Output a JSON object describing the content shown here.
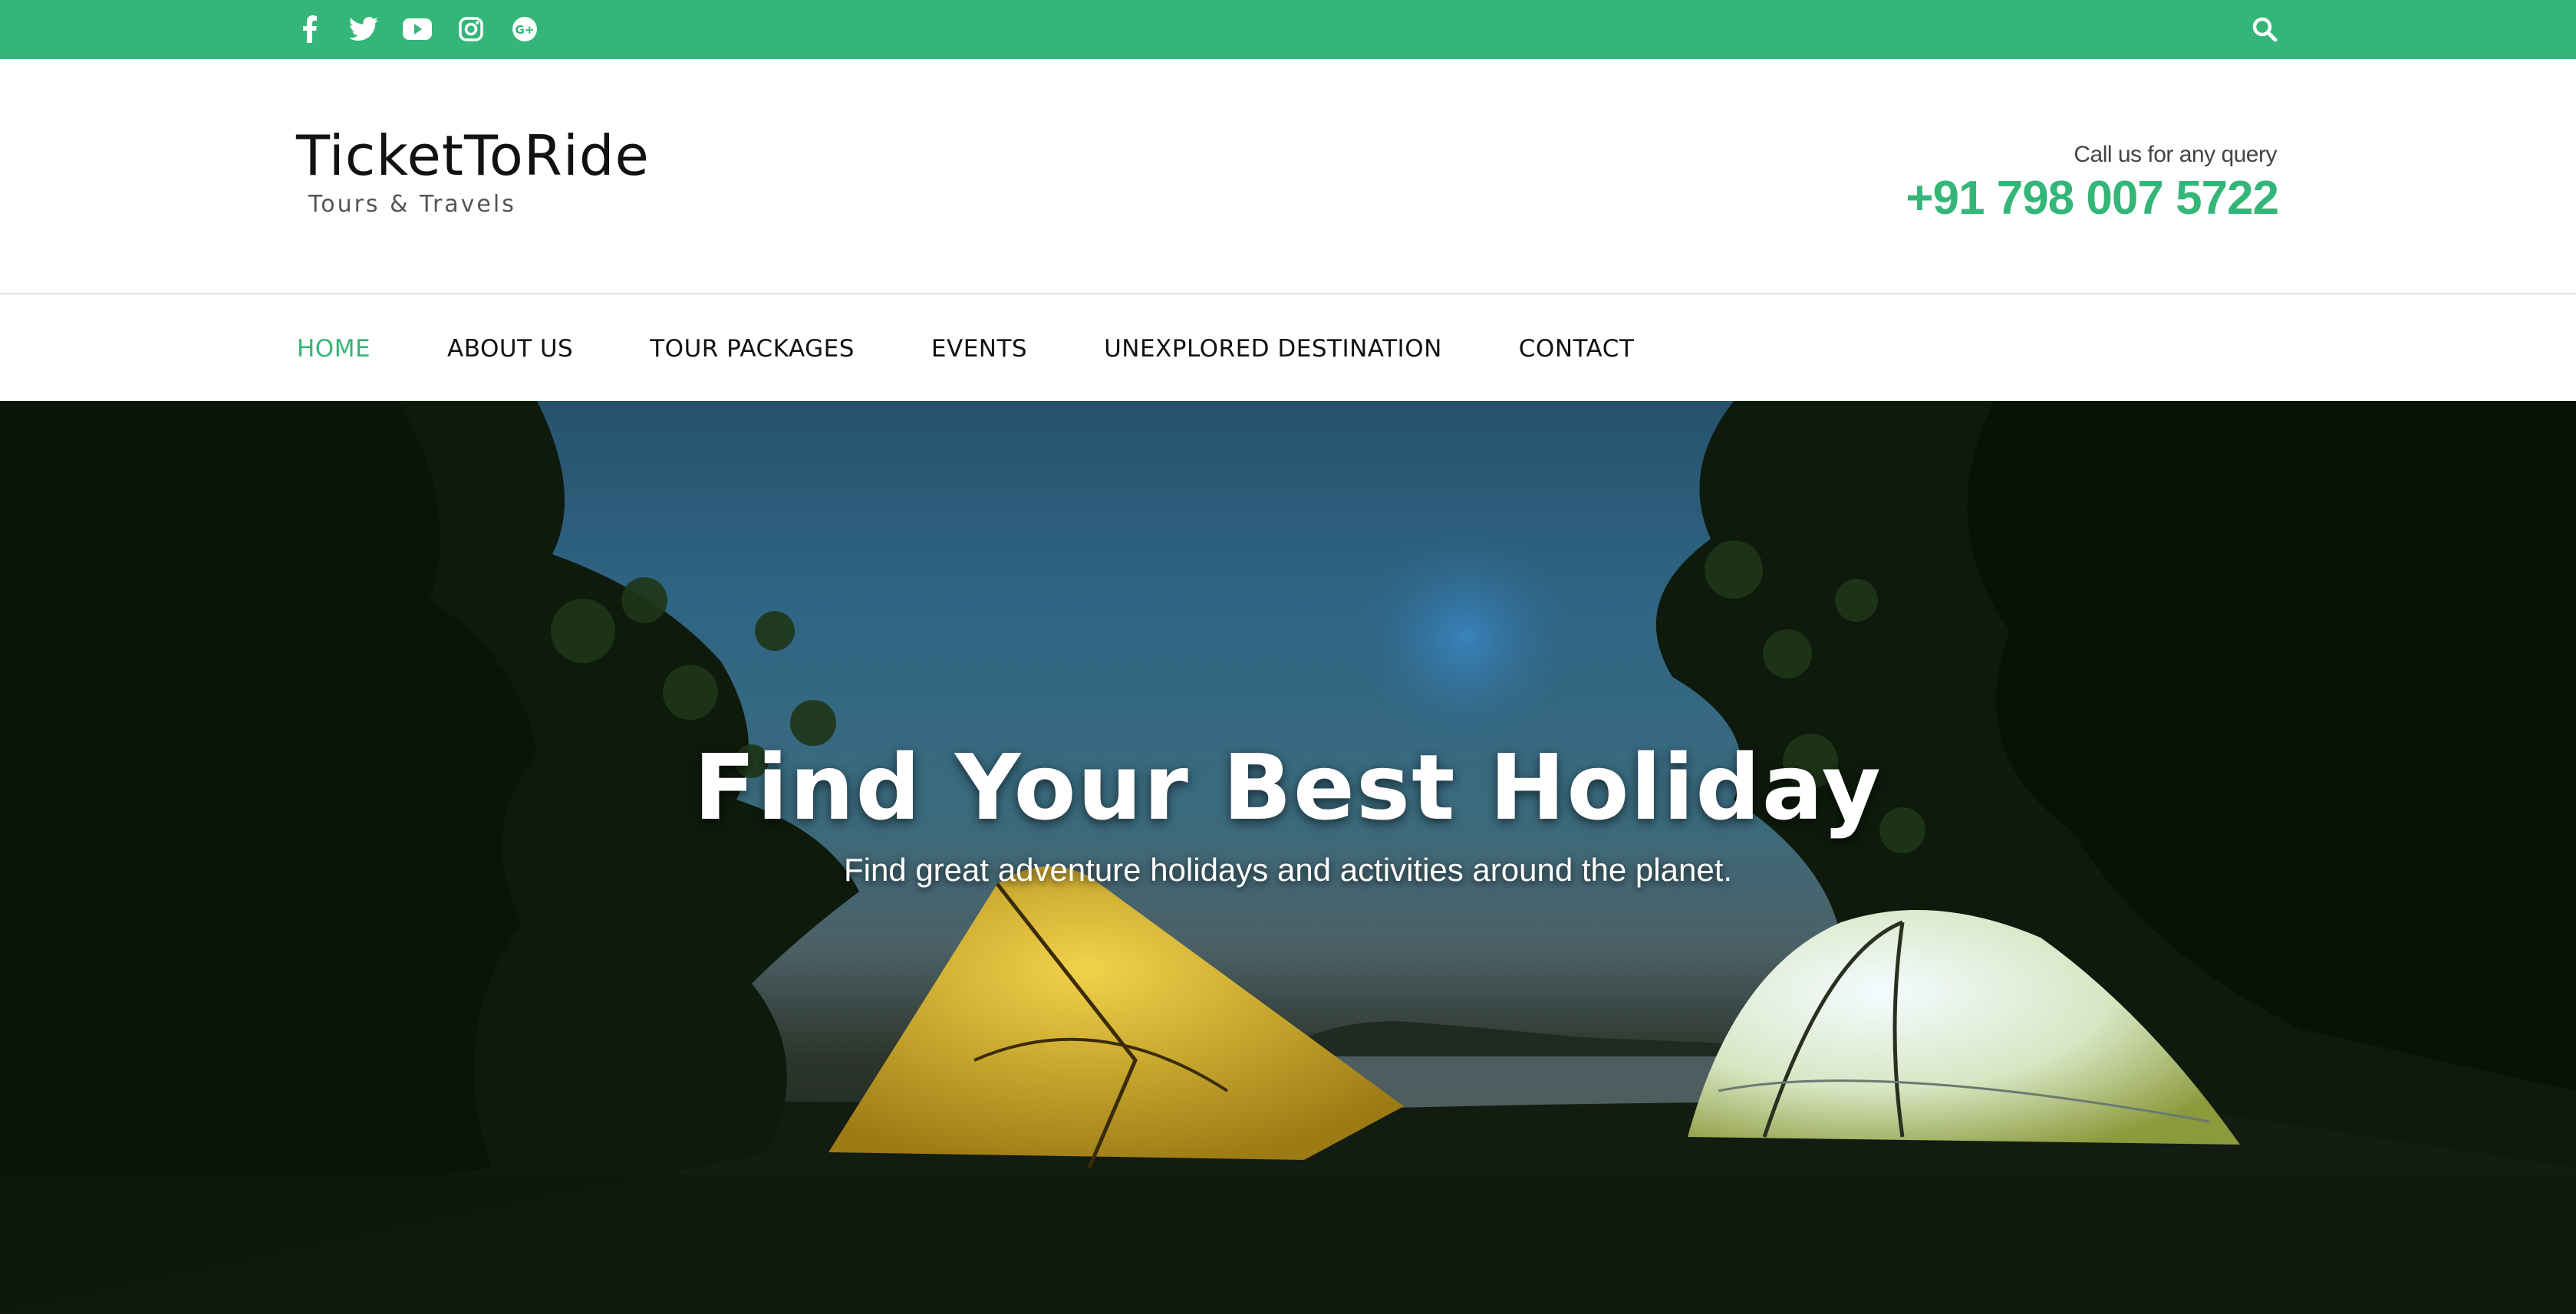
{
  "topbar": {
    "background": "#33b677",
    "social_icons": [
      "facebook-icon",
      "twitter-icon",
      "youtube-icon",
      "instagram-icon",
      "google-plus-icon"
    ],
    "search_icon": "search-icon"
  },
  "header": {
    "logo_title": "TicketToRide",
    "logo_subtitle": "Tours & Travels",
    "call_label": "Call us for any query",
    "phone": "+91 798 007 5722",
    "accent_color": "#33b677"
  },
  "nav": {
    "items": [
      {
        "label": "HOME",
        "active": true
      },
      {
        "label": "ABOUT US",
        "active": false
      },
      {
        "label": "TOUR PACKAGES",
        "active": false
      },
      {
        "label": "EVENTS",
        "active": false
      },
      {
        "label": "UNEXPLORED DESTINATION",
        "active": false
      },
      {
        "label": "CONTACT",
        "active": false
      }
    ]
  },
  "hero": {
    "title": "Find Your Best Holiday",
    "subtitle": "Find great adventure holidays and activities around the planet."
  }
}
